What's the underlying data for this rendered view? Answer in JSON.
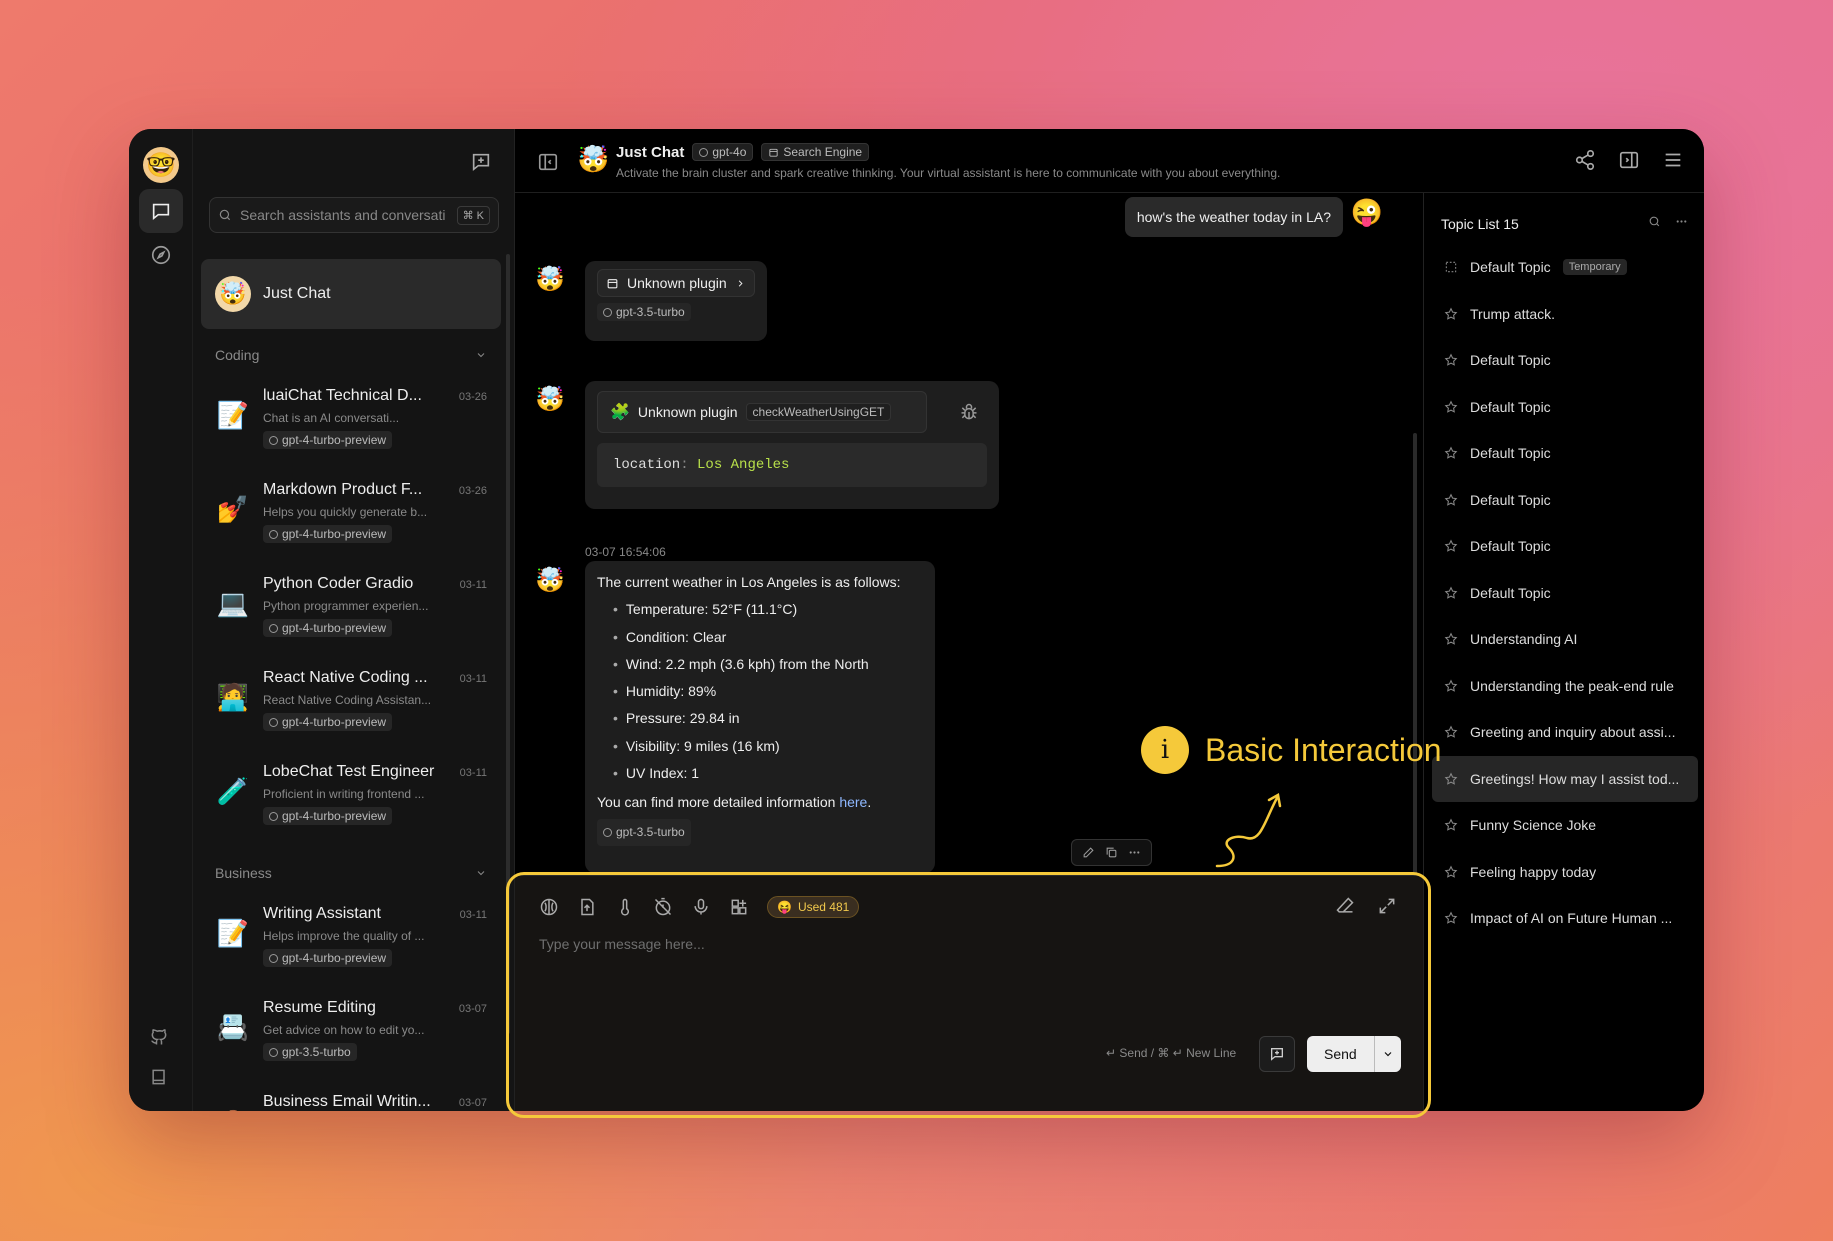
{
  "rail": {
    "avatar": "🤓"
  },
  "search": {
    "placeholder": "Search assistants and conversati",
    "shortcut": "⌘ K"
  },
  "just_chat": {
    "label": "Just Chat",
    "avatar": "🤯"
  },
  "groups": {
    "coding": "Coding",
    "business": "Business"
  },
  "agents": [
    {
      "icon": "📝",
      "title": "luaiChat Technical D...",
      "desc": "Chat is an AI conversati...",
      "date": "03-26",
      "model": "gpt-4-turbo-preview"
    },
    {
      "icon": "💅",
      "title": "Markdown Product F...",
      "desc": "Helps you quickly generate b...",
      "date": "03-26",
      "model": "gpt-4-turbo-preview"
    },
    {
      "icon": "💻",
      "title": "Python Coder Gradio",
      "desc": "Python programmer experien...",
      "date": "03-11",
      "model": "gpt-4-turbo-preview"
    },
    {
      "icon": "🧑‍💻",
      "title": "React Native Coding ...",
      "desc": "React Native Coding Assistan...",
      "date": "03-11",
      "model": "gpt-4-turbo-preview"
    },
    {
      "icon": "🧪",
      "title": "LobeChat Test Engineer",
      "desc": "Proficient in writing frontend ...",
      "date": "03-11",
      "model": "gpt-4-turbo-preview"
    },
    {
      "icon": "📝",
      "title": "Writing Assistant",
      "desc": "Helps improve the quality of ...",
      "date": "03-11",
      "model": "gpt-4-turbo-preview"
    },
    {
      "icon": "📇",
      "title": "Resume Editing",
      "desc": "Get advice on how to edit yo...",
      "date": "03-07",
      "model": "gpt-3.5-turbo"
    },
    {
      "icon": "💼",
      "title": "Business Email Writin...",
      "desc": "",
      "date": "03-07",
      "model": ""
    }
  ],
  "header": {
    "avatar": "🤯",
    "title": "Just Chat",
    "model": "gpt-4o",
    "plugin": "Search Engine",
    "desc": "Activate the brain cluster and spark creative thinking. Your virtual assistant is here to communicate with you about everything."
  },
  "chat": {
    "user_msg": "how's the weather today in LA?",
    "user_avatar": "😜",
    "bot_avatar": "🤯",
    "msg1": {
      "plugin": "Unknown plugin",
      "model": "gpt-3.5-turbo"
    },
    "msg2": {
      "plugin": "Unknown plugin",
      "api": "checkWeatherUsingGET",
      "key": "location",
      "value": "Los Angeles"
    },
    "msg3": {
      "time": "03-07 16:54:06",
      "intro": "The current weather in Los Angeles is as follows:",
      "items": [
        "Temperature: 52°F (11.1°C)",
        "Condition: Clear",
        "Wind: 2.2 mph (3.6 kph) from the North",
        "Humidity: 89%",
        "Pressure: 29.84 in",
        "Visibility: 9 miles (16 km)",
        "UV Index: 1"
      ],
      "outro": "You can find more detailed information ",
      "link": "here",
      "end": ".",
      "model": "gpt-3.5-turbo"
    }
  },
  "input": {
    "used_emoji": "😝",
    "used": "Used 481",
    "placeholder": "Type your message here...",
    "hint": "↵ Send / ⌘ ↵ New Line",
    "send": "Send"
  },
  "topics": {
    "title": "Topic List 15",
    "temporary": "Temporary",
    "items": [
      "Default Topic",
      "Trump attack.",
      "Default Topic",
      "Default Topic",
      "Default Topic",
      "Default Topic",
      "Default Topic",
      "Default Topic",
      "Understanding AI",
      "Understanding the peak-end rule",
      "Greeting and inquiry about assi...",
      "Greetings! How may I assist tod...",
      "Funny Science Joke",
      "Feeling happy today",
      "Impact of AI on Future Human ..."
    ]
  },
  "annotation": {
    "icon": "i",
    "label": "Basic Interaction",
    "color": "#f5c93a"
  }
}
